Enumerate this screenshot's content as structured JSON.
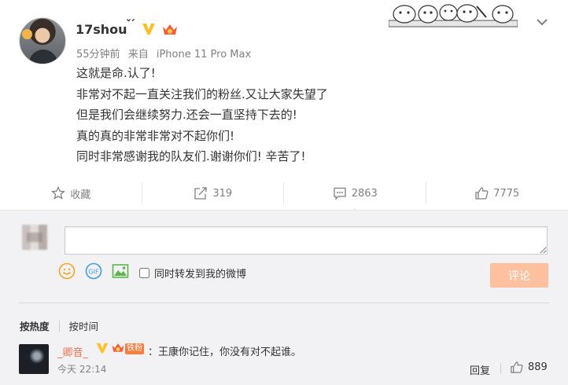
{
  "post": {
    "username": "17shou",
    "name_mark": "ˇˊ",
    "meta": {
      "time": "55分钟前",
      "source_prefix": "来自",
      "source": "iPhone 11 Pro Max"
    },
    "lines": [
      "这就是命.认了!",
      "非常对不起一直关注我们的粉丝.又让大家失望了",
      "但是我们会继续努力.还会一直坚持下去的!",
      "真的真的非常非常对不起你们!",
      "同时非常感谢我的队友们.谢谢你们!  辛苦了!"
    ]
  },
  "actions": {
    "favorite": {
      "label": "收藏",
      "icon": "star-icon"
    },
    "forward": {
      "count": "319",
      "icon": "share-icon"
    },
    "comment": {
      "count": "2863",
      "icon": "comment-icon"
    },
    "like": {
      "count": "7775",
      "icon": "thumbs-up-icon"
    }
  },
  "compose": {
    "input_value": "",
    "forward_label": "同时转发到我的微博",
    "submit_label": "评论",
    "gif_label": "GIF"
  },
  "sort": {
    "hot": "按热度",
    "time": "按时间"
  },
  "comments": [
    {
      "user": "_卿音_",
      "badge": "铁粉",
      "text": "：王康你记住，你没有对不起谁。",
      "time": "今天 22:14",
      "reply_label": "回复",
      "likes": "889"
    }
  ],
  "colors": {
    "accent": "#eb7350",
    "vip": "#ffc02a",
    "submit_disabled": "#ffc09f",
    "badge": "#fa7d3c"
  }
}
